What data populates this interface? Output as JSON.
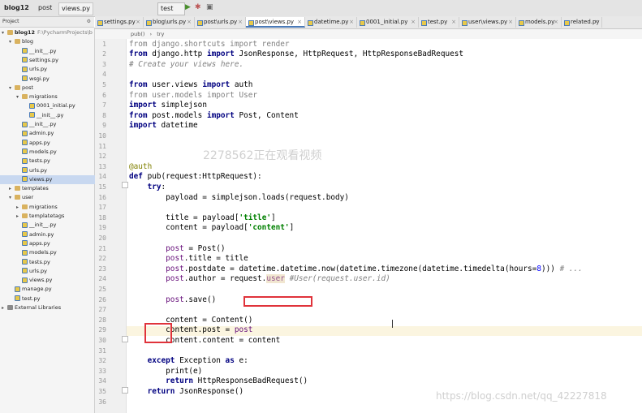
{
  "toolbar": {
    "project_label": "blog12",
    "crumb_post": "post",
    "crumb_file": "views.py",
    "run_config": "test"
  },
  "project_panel": {
    "header_label": "Project",
    "tree": [
      {
        "label": "blog12",
        "sub": "F:\\PycharmProjects\\b",
        "indent": 0,
        "type": "folder",
        "arrow": "▾"
      },
      {
        "label": "blog",
        "indent": 1,
        "type": "folder",
        "arrow": "▾"
      },
      {
        "label": "__init__.py",
        "indent": 2,
        "type": "py"
      },
      {
        "label": "settings.py",
        "indent": 2,
        "type": "py"
      },
      {
        "label": "urls.py",
        "indent": 2,
        "type": "py"
      },
      {
        "label": "wsgi.py",
        "indent": 2,
        "type": "py"
      },
      {
        "label": "post",
        "indent": 1,
        "type": "folder",
        "arrow": "▾"
      },
      {
        "label": "migrations",
        "indent": 2,
        "type": "folder",
        "arrow": "▾"
      },
      {
        "label": "0001_initial.py",
        "indent": 3,
        "type": "py"
      },
      {
        "label": "__init__.py",
        "indent": 3,
        "type": "py"
      },
      {
        "label": "__init__.py",
        "indent": 2,
        "type": "py"
      },
      {
        "label": "admin.py",
        "indent": 2,
        "type": "py"
      },
      {
        "label": "apps.py",
        "indent": 2,
        "type": "py"
      },
      {
        "label": "models.py",
        "indent": 2,
        "type": "py"
      },
      {
        "label": "tests.py",
        "indent": 2,
        "type": "py"
      },
      {
        "label": "urls.py",
        "indent": 2,
        "type": "py"
      },
      {
        "label": "views.py",
        "indent": 2,
        "type": "py",
        "selected": true
      },
      {
        "label": "templates",
        "indent": 1,
        "type": "folder",
        "arrow": "▸"
      },
      {
        "label": "user",
        "indent": 1,
        "type": "folder",
        "arrow": "▾"
      },
      {
        "label": "migrations",
        "indent": 2,
        "type": "folder",
        "arrow": "▸"
      },
      {
        "label": "templatetags",
        "indent": 2,
        "type": "folder",
        "arrow": "▸"
      },
      {
        "label": "__init__.py",
        "indent": 2,
        "type": "py"
      },
      {
        "label": "admin.py",
        "indent": 2,
        "type": "py"
      },
      {
        "label": "apps.py",
        "indent": 2,
        "type": "py"
      },
      {
        "label": "models.py",
        "indent": 2,
        "type": "py"
      },
      {
        "label": "tests.py",
        "indent": 2,
        "type": "py"
      },
      {
        "label": "urls.py",
        "indent": 2,
        "type": "py"
      },
      {
        "label": "views.py",
        "indent": 2,
        "type": "py"
      },
      {
        "label": "manage.py",
        "indent": 1,
        "type": "py"
      },
      {
        "label": "test.py",
        "indent": 1,
        "type": "py"
      },
      {
        "label": "External Libraries",
        "indent": 0,
        "type": "lib",
        "arrow": "▸"
      }
    ]
  },
  "tabs": [
    {
      "label": "settings.py"
    },
    {
      "label": "blog\\urls.py"
    },
    {
      "label": "post\\urls.py"
    },
    {
      "label": "post\\views.py",
      "active": true
    },
    {
      "label": "datetime.py"
    },
    {
      "label": "0001_initial.py"
    },
    {
      "label": "test.py"
    },
    {
      "label": "user\\views.py"
    },
    {
      "label": "models.py"
    },
    {
      "label": "related.py"
    }
  ],
  "breadcrumb": {
    "fn": "pub()",
    "sep": "›",
    "block": "try"
  },
  "editor": {
    "line_numbers": [
      "1",
      "2",
      "3",
      "4",
      "5",
      "6",
      "7",
      "8",
      "9",
      "10",
      "11",
      "12",
      "13",
      "14",
      "15",
      "16",
      "17",
      "18",
      "19",
      "20",
      "21",
      "22",
      "23",
      "24",
      "25",
      "26",
      "27",
      "28",
      "29",
      "30",
      "31",
      "32",
      "33",
      "34",
      "35",
      "36"
    ],
    "lines": [
      "<span class=\"gray\">from django.shortcuts import render</span>",
      "<span class=\"kw\">from</span> django.http <span class=\"kw\">import</span> JsonResponse, HttpRequest, HttpResponseBadRequest",
      "<span class=\"cmt\"># Create your views here.</span>",
      "",
      "<span class=\"kw\">from</span> user.views <span class=\"kw\">import</span> auth",
      "<span class=\"gray\">from user.models import User</span>",
      "<span class=\"kw\">import</span> simplejson",
      "<span class=\"kw\">from</span> post.models <span class=\"kw\">import</span> Post, Content",
      "<span class=\"kw\">import</span> datetime",
      "",
      "",
      "",
      "<span class=\"dec\">@auth</span>",
      "<span class=\"kw\">def</span> pub(request:HttpRequest):",
      "    <span class=\"kw\">try</span>:",
      "        payload = simplejson.loads(request.body)",
      "",
      "        title = payload[<span class=\"str\">'title'</span>]",
      "        content = payload[<span class=\"str\">'content'</span>]",
      "",
      "        <span class=\"selfvar\">post</span> = Post()",
      "        <span class=\"selfvar\">post</span>.title = title",
      "        <span class=\"selfvar\">post</span>.postdate = datetime.datetime.now(datetime.timezone(datetime.timedelta(hours=<span style=\"color:#0000ff\">8</span>))) <span class=\"cmt\"># ...</span>",
      "        <span class=\"selfvar\">post</span>.author = request.<span class=\"pur\" style=\"background:#f1e6d0\">user</span> <span class=\"cmt\">#User(request.user.id)</span>",
      "",
      "        <span class=\"selfvar\">post</span>.save()",
      "",
      "        content = Content()",
      "        content.post = <span class=\"selfvar\">post</span>",
      "        content.content = content",
      "",
      "    <span class=\"kw\">except</span> Exception <span class=\"kw\">as</span> e:",
      "        print(e)",
      "        <span class=\"kw\">return</span> HttpResponseBadRequest()",
      "    <span class=\"kw\">return</span> JsonResponse()",
      ""
    ]
  },
  "overlay": {
    "viewer_watermark": "2278562正在观看视频",
    "site_watermark": "https://blog.csdn.net/qq_42227818"
  }
}
